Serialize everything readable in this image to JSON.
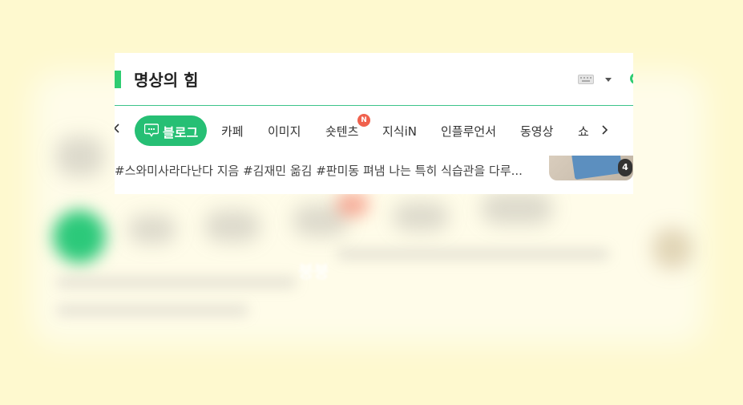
{
  "search": {
    "query": "명상의 힘"
  },
  "tabs": {
    "active": "블로그",
    "items": [
      "카페",
      "이미지",
      "숏텐츠",
      "지식iN",
      "인플루언서",
      "동영상",
      "쇼"
    ],
    "new_badge": "N"
  },
  "result": {
    "snippet": "#스와미사라다난다 지음 #김재민 옮김 #판미동 펴냄 나는 특히 식습관을 다루...",
    "image_count": "4"
  },
  "background": {
    "blurred_text": "붕붕"
  },
  "colors": {
    "background": "#fef9cf",
    "accent_green": "#26bf74",
    "badge_red": "#f0614d"
  },
  "icons": {
    "prev": "chevron-left-icon",
    "next": "chevron-right-icon",
    "blog": "blog-speech-icon",
    "keyboard": "keyboard-icon",
    "dropdown": "caret-down-icon"
  }
}
